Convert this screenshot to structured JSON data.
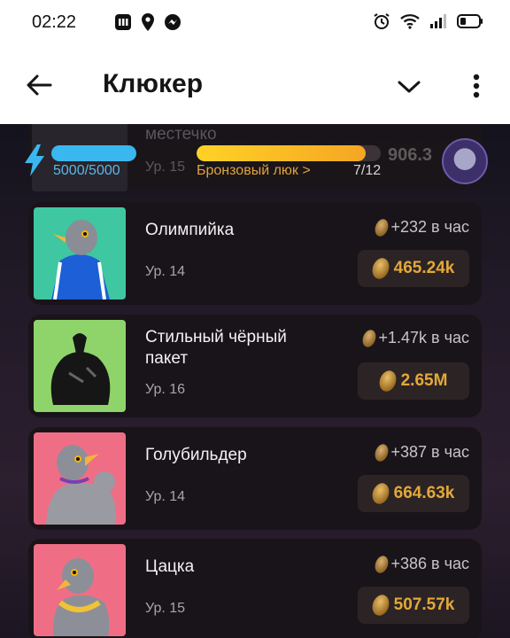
{
  "status_bar": {
    "time": "02:22"
  },
  "app_bar": {
    "title": "Клюкер"
  },
  "top_overlay": {
    "ghost_name": "местечко",
    "ghost_level": "Ур. 15",
    "ghost_value": "906.3",
    "energy_text": "5000/5000",
    "energy_fraction": 1.0,
    "rank_label": "Бронзовый люк >",
    "rank_count": "7/12",
    "rank_fraction": 0.92
  },
  "items": [
    {
      "name": "Олимпийка",
      "level": "Ур. 14",
      "rate": "+232 в час",
      "balance": "465.24k",
      "bg": "#3ec7a0"
    },
    {
      "name": "Стильный чёрный пакет",
      "level": "Ур. 16",
      "rate": "+1.47k в час",
      "balance": "2.65M",
      "bg": "#8fd46b"
    },
    {
      "name": "Голубильдер",
      "level": "Ур. 14",
      "rate": "+387 в час",
      "balance": "664.63k",
      "bg": "#ef6e86"
    },
    {
      "name": "Цацка",
      "level": "Ур. 15",
      "rate": "+386 в час",
      "balance": "507.57k",
      "bg": "#ef6e86"
    }
  ],
  "colors": {
    "accent": "#e3a83a",
    "energy": "#3ab7ef"
  }
}
